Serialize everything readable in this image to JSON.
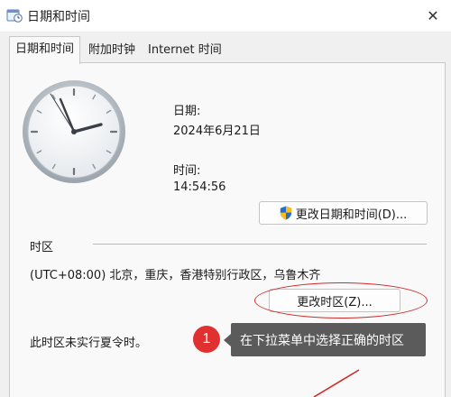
{
  "window": {
    "title": "日期和时间",
    "close_glyph": "✕"
  },
  "tabs": [
    {
      "label": "日期和时间",
      "active": true
    },
    {
      "label": "附加时钟",
      "active": false
    },
    {
      "label": "Internet 时间",
      "active": false
    }
  ],
  "datetime": {
    "date_label": "日期:",
    "date_value": "2024年6月21日",
    "time_label": "时间:",
    "time_value": "14:54:56",
    "change_button": "更改日期和时间(D)..."
  },
  "timezone": {
    "section_label": "时区",
    "value": "(UTC+08:00) 北京，重庆，香港特别行政区，乌鲁木齐",
    "change_button": "更改时区(Z)...",
    "dst_note": "此时区未实行夏令时。"
  },
  "annotation": {
    "step_number": "1",
    "callout_text": "在下拉菜单中选择正确的时区",
    "highlight_color": "#d02a2a",
    "callout_color": "#5b5b5b"
  },
  "icons": {
    "app": "calendar-clock-icon",
    "shield": "uac-shield-icon",
    "clock": "analog-clock-icon"
  }
}
